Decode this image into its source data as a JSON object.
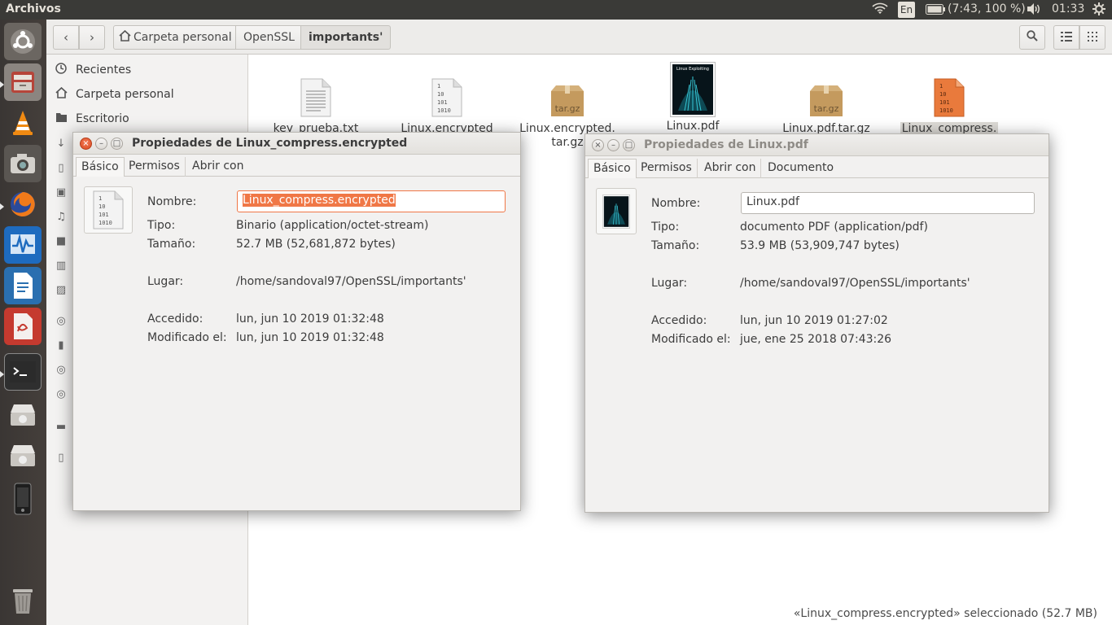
{
  "top_panel": {
    "app_title": "Archivos",
    "keyboard": "En",
    "battery": "(7:43, 100 %)",
    "clock": "01:33"
  },
  "header": {
    "breadcrumbs": [
      "Carpeta personal",
      "OpenSSL",
      "importants'"
    ]
  },
  "sidebar": {
    "items": [
      {
        "label": "Recientes",
        "icon": "clock-icon"
      },
      {
        "label": "Carpeta personal",
        "icon": "home-icon"
      },
      {
        "label": "Escritorio",
        "icon": "folder-icon"
      }
    ]
  },
  "files": [
    {
      "name": "key_prueba.txt",
      "icon": "text-file-icon"
    },
    {
      "name": "Linux.encrypted",
      "icon": "binary-file-icon"
    },
    {
      "name_line1": "Linux.encrypted.",
      "name_line2": "tar.gz",
      "icon": "archive-icon",
      "badge": "tar.gz"
    },
    {
      "name": "Linux.pdf",
      "icon": "pdf-thumbnail-icon",
      "cover_title": "Linux Exploiting"
    },
    {
      "name": "Linux.pdf.tar.gz",
      "icon": "archive-icon",
      "badge": "tar.gz"
    },
    {
      "name": "Linux_compress.",
      "icon": "binary-file-icon-selected"
    }
  ],
  "binary_glyph": [
    "1",
    "10",
    "101",
    "1010"
  ],
  "status_bar": "«Linux_compress.encrypted» seleccionado  (52.7 MB)",
  "dialog1": {
    "title": "Propiedades de Linux_compress.encrypted",
    "tabs": [
      "Básico",
      "Permisos",
      "Abrir con"
    ],
    "labels": {
      "name": "Nombre:",
      "type": "Tipo:",
      "size": "Tamaño:",
      "location": "Lugar:",
      "accessed": "Accedido:",
      "modified": "Modificado el:"
    },
    "name": "Linux_compress.encrypted",
    "type": "Binario (application/octet-stream)",
    "size": "52.7 MB (52,681,872 bytes)",
    "location": "/home/sandoval97/OpenSSL/importants'",
    "accessed": "lun, jun 10 2019 01:32:48",
    "modified": "lun, jun 10 2019 01:32:48"
  },
  "dialog2": {
    "title": "Propiedades de Linux.pdf",
    "tabs": [
      "Básico",
      "Permisos",
      "Abrir con",
      "Documento"
    ],
    "labels": {
      "name": "Nombre:",
      "type": "Tipo:",
      "size": "Tamaño:",
      "location": "Lugar:",
      "accessed": "Accedido:",
      "modified": "Modificado el:"
    },
    "name": "Linux.pdf",
    "type": "documento PDF (application/pdf)",
    "size": "53.9 MB (53,909,747 bytes)",
    "location": "/home/sandoval97/OpenSSL/importants'",
    "accessed": "lun, jun 10 2019 01:27:02",
    "modified": "jue, ene 25 2018 07:43:26"
  }
}
